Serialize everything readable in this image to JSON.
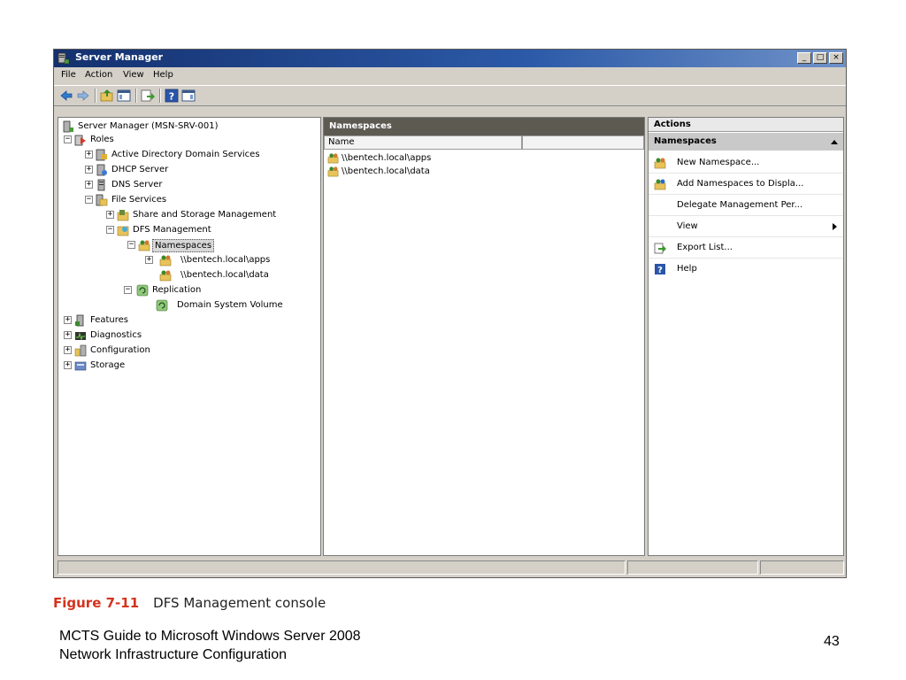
{
  "window": {
    "title": "Server Manager",
    "caption_buttons": {
      "minimize": "_",
      "maximize": "□",
      "close": "×"
    }
  },
  "menu": [
    "File",
    "Action",
    "View",
    "Help"
  ],
  "toolbar": [
    "back-arrow-icon",
    "forward-arrow-icon",
    "up-folder-icon",
    "show-hide-console-tree-icon",
    "export-list-icon",
    "help-icon",
    "show-hide-action-pane-icon"
  ],
  "tree": {
    "root": "Server Manager (MSN-SRV-001)",
    "roles": "Roles",
    "ad": "Active Directory Domain Services",
    "dhcp": "DHCP Server",
    "dns": "DNS Server",
    "file_services": "File Services",
    "share_storage": "Share and Storage Management",
    "dfs_mgmt": "DFS Management",
    "namespaces": "Namespaces",
    "ns_apps": "\\\\bentech.local\\apps",
    "ns_data": "\\\\bentech.local\\data",
    "replication": "Replication",
    "dsv": "Domain System Volume",
    "features": "Features",
    "diagnostics": "Diagnostics",
    "configuration": "Configuration",
    "storage": "Storage"
  },
  "middle": {
    "title": "Namespaces",
    "column": "Name",
    "rows": [
      "\\\\bentech.local\\apps",
      "\\\\bentech.local\\data"
    ]
  },
  "actions": {
    "title": "Actions",
    "section": "Namespaces",
    "items": [
      "New Namespace...",
      "Add Namespaces to Displa...",
      "Delegate Management Per...",
      "View",
      "Export List...",
      "Help"
    ]
  },
  "caption": {
    "figure": "Figure 7-11",
    "text": "DFS Management console"
  },
  "footer": {
    "line1": "MCTS Guide to Microsoft Windows Server 2008",
    "line2": "Network Infrastructure Configuration",
    "page": "43"
  },
  "colors": {
    "title_bar": "#14306e",
    "pane_header": "#5d5a52",
    "figure_label": "#d4331d"
  }
}
